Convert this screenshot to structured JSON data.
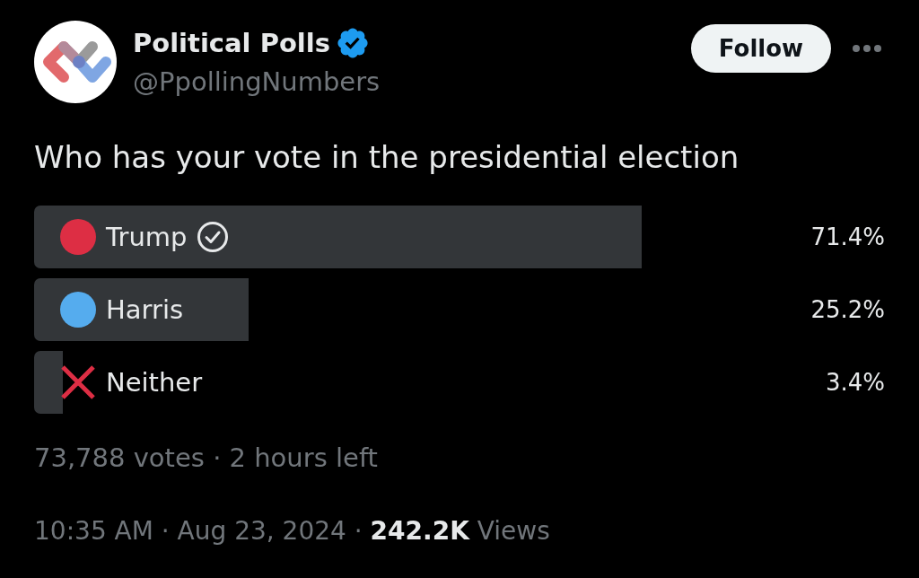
{
  "author": {
    "name": "Political Polls",
    "verified": true,
    "handle": "@PpollingNumbers"
  },
  "follow_button": {
    "label": "Follow"
  },
  "text": "Who has your vote in the presidential election",
  "poll": {
    "options": [
      {
        "label": "Trump",
        "kind": "dot",
        "color": "#dd2e44",
        "selected": true,
        "level": 0.714,
        "percent": "71.4%"
      },
      {
        "label": "Harris",
        "kind": "dot",
        "color": "#55acee",
        "selected": false,
        "level": 0.252,
        "percent": "25.2%"
      },
      {
        "label": "Neither",
        "kind": "cross",
        "color": "#dd2e44",
        "selected": false,
        "level": 0.034,
        "percent": "3.4%"
      }
    ],
    "summary": "73,788 votes · 2 hours left"
  },
  "meta": "10:35 AM · Aug 23, 2024 · **242.2K** Views"
}
